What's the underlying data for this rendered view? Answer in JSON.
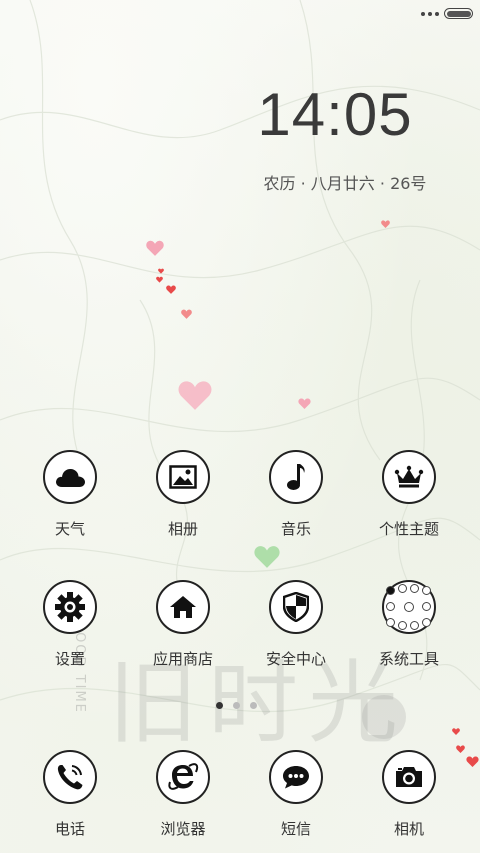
{
  "clock": {
    "time": "14:05",
    "lunar_date": "农历 · 八月廿六 · 26号"
  },
  "apps": {
    "weather": "天气",
    "album": "相册",
    "music": "音乐",
    "theme": "个性主题",
    "settings": "设置",
    "app_store": "应用商店",
    "security": "安全中心",
    "system_tools": "系统工具",
    "phone": "电话",
    "browser": "浏览器",
    "sms": "短信",
    "camera": "相机"
  },
  "page_indicator": {
    "pages": 3,
    "active": 1
  },
  "watermark": {
    "text": "旧时光",
    "vertical": "GOOD TIME"
  },
  "colors": {
    "icon_stroke": "#222222",
    "icon_bg": "#ffffff",
    "heart_red": "#e84a4a",
    "heart_pink": "#f4a6b6",
    "heart_green": "#a6dca2"
  }
}
